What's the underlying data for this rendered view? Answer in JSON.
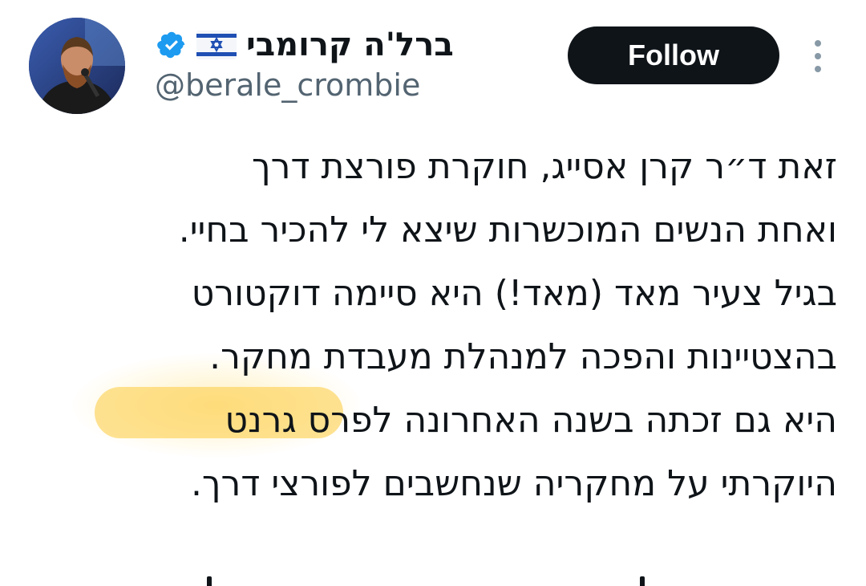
{
  "header": {
    "display_name": "ברל'ה קרומבי",
    "handle": "@berale_crombie",
    "follow_label": "Follow"
  },
  "icons": {
    "verified": "verified-badge-icon",
    "flag": "israel-flag-icon",
    "more": "more-options-icon",
    "avatar": "profile-avatar"
  },
  "colors": {
    "follow_bg": "#0f1419",
    "verified_blue": "#1d9bf0",
    "handle_gray": "#536471",
    "highlight_yellow": "#fdd050"
  },
  "tweet": {
    "lines": [
      "זאת ד״ר קרן אסייג, חוקרת פורצת דרך",
      "ואחת הנשים המוכשרות שיצא לי להכיר בחיי.",
      "בגיל צעיר מאד (מאד!) היא סיימה דוקטורט",
      "בהצטיינות והפכה למנהלת מעבדת מחקר.",
      "היא גם זכתה בשנה האחרונה לפרס גרנט",
      "היוקרתי על מחקריה שנחשבים לפורצי דרך."
    ]
  }
}
